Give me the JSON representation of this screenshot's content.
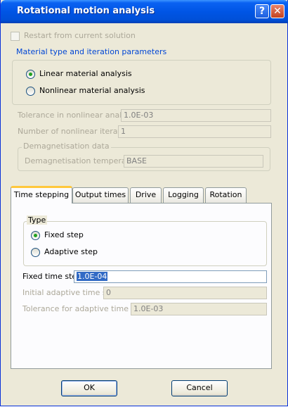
{
  "window": {
    "title": "Rotational motion analysis",
    "help_glyph": "?",
    "close_glyph": "✕"
  },
  "restart": {
    "label": "Restart from current solution",
    "checked": false
  },
  "material_group": {
    "label": "Material type and iteration parameters",
    "options": [
      "Linear material analysis",
      "Nonlinear material analysis"
    ],
    "selected": "Linear material analysis"
  },
  "tolerance_nonlinear": {
    "label": "Tolerance in nonlinear analysis",
    "value": "1.0E-03"
  },
  "nonlinear_iterations": {
    "label": "Number of nonlinear iterations",
    "value": "1"
  },
  "demag": {
    "group_label": "Demagnetisation data",
    "temp_label": "Demagnetisation temperature",
    "temp_value": "BASE"
  },
  "tabs": [
    "Time stepping",
    "Output times",
    "Drive",
    "Logging",
    "Rotation"
  ],
  "active_tab": "Time stepping",
  "time_stepping": {
    "type_label": "Type",
    "options": [
      "Fixed step",
      "Adaptive step"
    ],
    "selected": "Fixed step",
    "fixed_step_label": "Fixed time step",
    "fixed_step_value": "1.0E-04",
    "initial_adaptive_label": "Initial adaptive time step",
    "initial_adaptive_value": "0",
    "tolerance_adaptive_label": "Tolerance for adaptive time step",
    "tolerance_adaptive_value": "1.0E-03"
  },
  "buttons": {
    "ok": "OK",
    "cancel": "Cancel"
  }
}
